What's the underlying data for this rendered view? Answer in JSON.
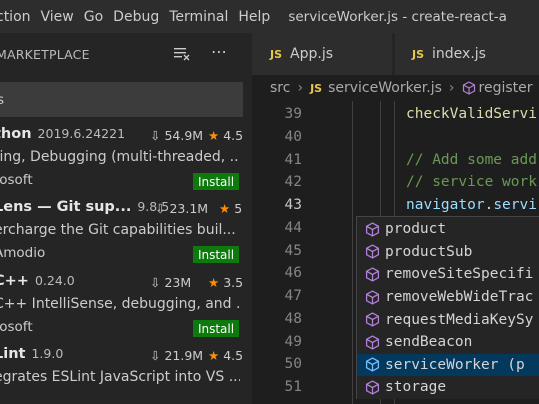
{
  "menubar": {
    "items": [
      "ction",
      "View",
      "Go",
      "Debug",
      "Terminal",
      "Help"
    ],
    "title": "serviceWorker.js - create-react-a"
  },
  "sidebar": {
    "header": "MARKETPLACE",
    "search_value": "s",
    "extensions": [
      {
        "name": "thon",
        "version": "2019.6.24221",
        "downloads": "54.9M",
        "rating": "4.5",
        "description": "ting, Debugging (multi-threaded, ...",
        "publisher": "rosoft",
        "install": "Install"
      },
      {
        "name": "Lens — Git sup...",
        "version": "9.8.5",
        "downloads": "23.1M",
        "rating": "5",
        "description": "ercharge the Git capabilities buil...",
        "publisher": "Amodio",
        "install": "Install"
      },
      {
        "name": "C++",
        "version": "0.24.0",
        "downloads": "23M",
        "rating": "3.5",
        "description": "C++ IntelliSense, debugging, and ...",
        "publisher": "rosoft",
        "install": "Install"
      },
      {
        "name": "Lint",
        "version": "1.9.0",
        "downloads": "21.9M",
        "rating": "4.5",
        "description": "egrates ESLint JavaScript into VS ...",
        "publisher": "",
        "install": ""
      }
    ]
  },
  "tabs": [
    {
      "icon": "JS",
      "label": "App.js"
    },
    {
      "icon": "JS",
      "label": "index.js"
    }
  ],
  "breadcrumb": {
    "folder": "src",
    "file_icon": "JS",
    "file": "serviceWorker.js",
    "symbol": "register"
  },
  "editor": {
    "current_line": "43",
    "lines": [
      {
        "num": "39",
        "code": "checkValidServi"
      },
      {
        "num": "40",
        "code": ""
      },
      {
        "num": "41",
        "code": "// Add some add"
      },
      {
        "num": "42",
        "code": "// service work"
      },
      {
        "num": "43",
        "code_obj": "navigator",
        "code_dot": ".",
        "code_prop": "servi"
      },
      {
        "num": "44",
        "code": ""
      },
      {
        "num": "45",
        "code": ""
      },
      {
        "num": "46",
        "code": ""
      },
      {
        "num": "47",
        "code": ""
      },
      {
        "num": "48",
        "code": ""
      },
      {
        "num": "49",
        "code": ""
      },
      {
        "num": "50",
        "code": ""
      },
      {
        "num": "51",
        "code": ""
      }
    ]
  },
  "suggestions": {
    "selected_index": 6,
    "items": [
      "product",
      "productSub",
      "removeSiteSpecifi",
      "removeWebWideTrac",
      "requestMediaKeySy",
      "sendBeacon",
      "serviceWorker  (p",
      "storage"
    ]
  },
  "colors": {
    "install_bg": "#0e7a0d",
    "star": "#ff8e00",
    "js_icon": "#e8c84a",
    "selection": "#04395e",
    "comment": "#6a9955",
    "variable": "#9cdcfe",
    "function": "#dcdcaa",
    "suggest_icon": "#b180d7"
  }
}
